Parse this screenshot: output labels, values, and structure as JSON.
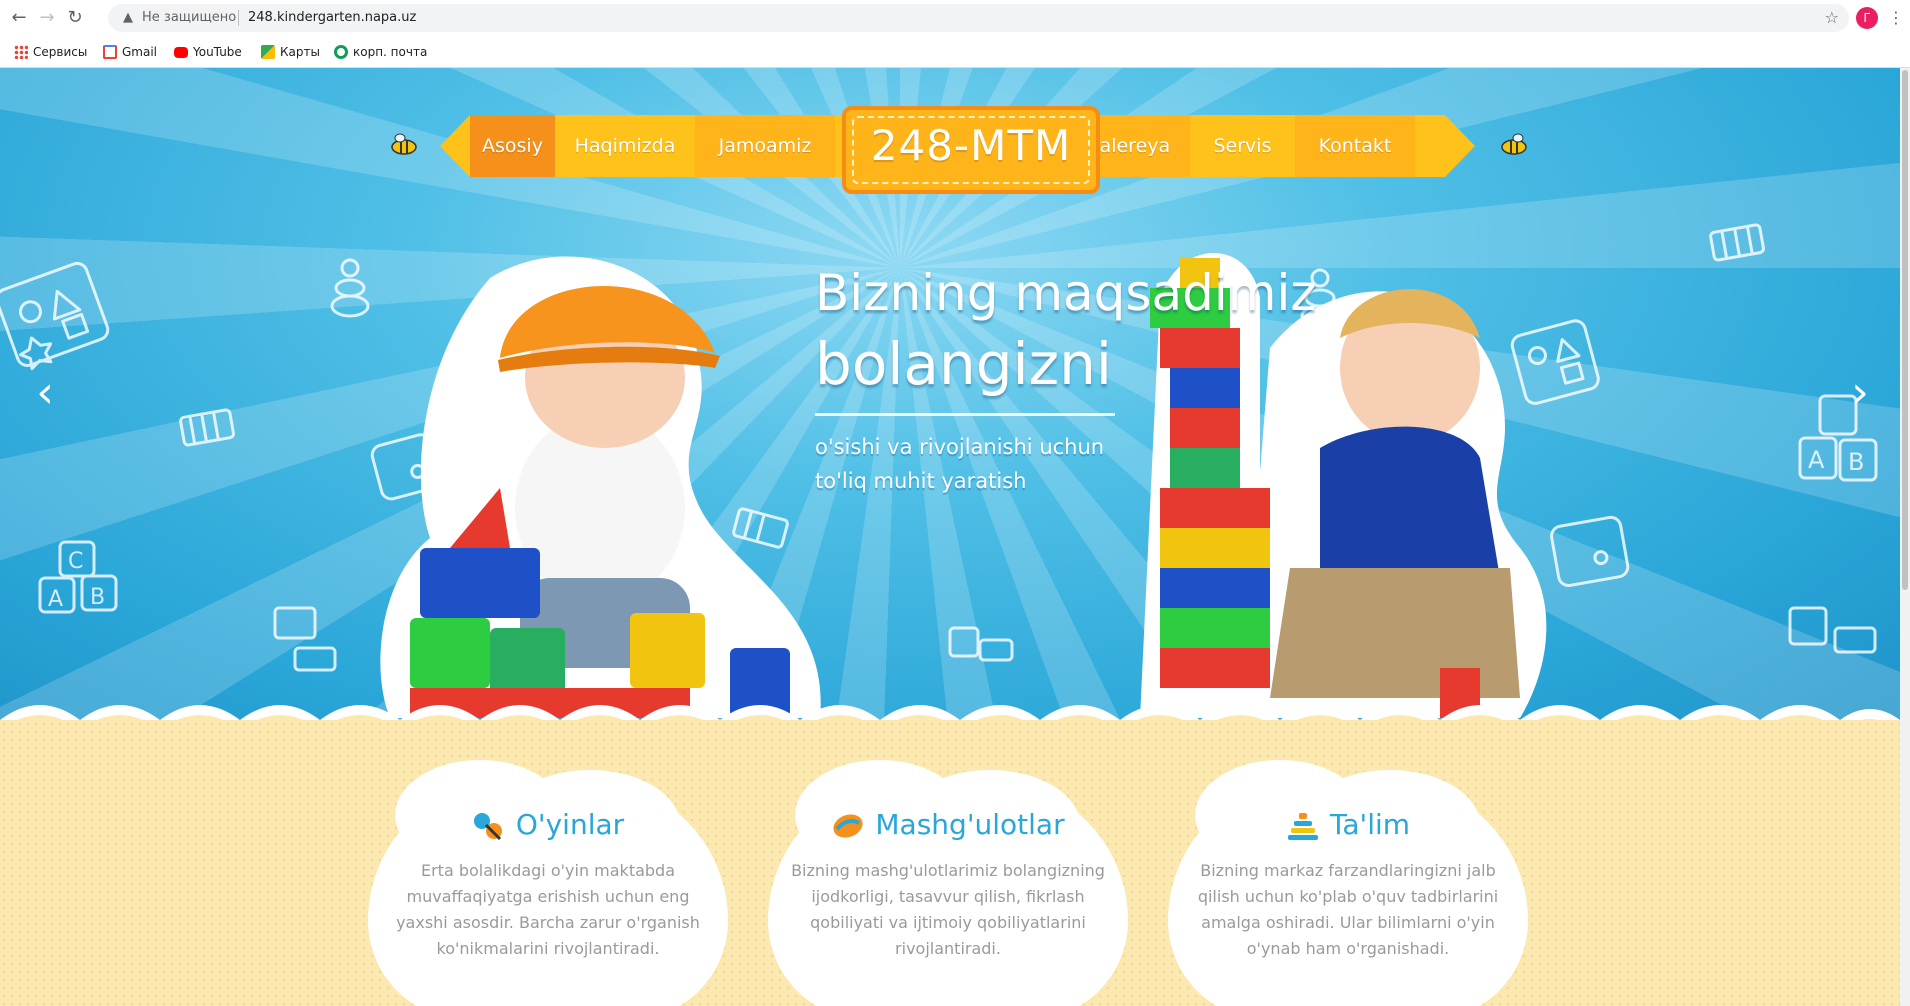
{
  "browser": {
    "security_label": "Не защищено",
    "url": "248.kindergarten.napa.uz",
    "profile_initial": "Г",
    "bookmarks": [
      {
        "label": "Сервисы",
        "icon": "apps-grid-icon"
      },
      {
        "label": "Gmail",
        "icon": "gmail-icon"
      },
      {
        "label": "YouTube",
        "icon": "youtube-icon"
      },
      {
        "label": "Карты",
        "icon": "maps-icon"
      },
      {
        "label": "корп. почта",
        "icon": "mail-ring-icon"
      }
    ]
  },
  "nav": {
    "items_left": [
      {
        "label": "Asosiy",
        "active": true
      },
      {
        "label": "Haqimizda",
        "active": false
      },
      {
        "label": "Jamoamiz",
        "active": false
      }
    ],
    "logo": "248-MTM",
    "items_right": [
      {
        "label": "Galereya",
        "active": false
      },
      {
        "label": "Servis",
        "active": false
      },
      {
        "label": "Kontakt",
        "active": false
      }
    ]
  },
  "hero": {
    "title_line1": "Bizning maqsadimiz",
    "title_line2": "bolangizni",
    "subtitle": "o'sishi va rivojlanishi uchun to'liq muhit yaratish"
  },
  "features": [
    {
      "title": "O'yinlar",
      "icon": "rattle-icon",
      "text": "Erta bolalikdagi o'yin maktabda muvaffaqiyatga erishish uchun eng yaxshi asosdir. Barcha zarur o'rganish ko'nikmalarini rivojlantiradi."
    },
    {
      "title": "Mashg'ulotlar",
      "icon": "ball-icon",
      "text": "Bizning mashg'ulotlarimiz bolangizning ijodkorligi, tasavvur qilish, fikrlash qobiliyati va ijtimoiy qobiliyatlarini rivojlantiradi."
    },
    {
      "title": "Ta'lim",
      "icon": "pyramid-icon",
      "text": "Bizning markaz farzandlaringizni jalb qilish uchun ko'plab o'quv tadbirlarini amalga oshiradi. Ular bilimlarni o'yin o'ynab ham o'rganishadi."
    }
  ],
  "colors": {
    "sky": "#2aa6d8",
    "ribbon": "#ffc21a",
    "ribbon_active": "#f5901a",
    "sand": "#fbe9b1",
    "feature_title": "#2aa6d8"
  }
}
